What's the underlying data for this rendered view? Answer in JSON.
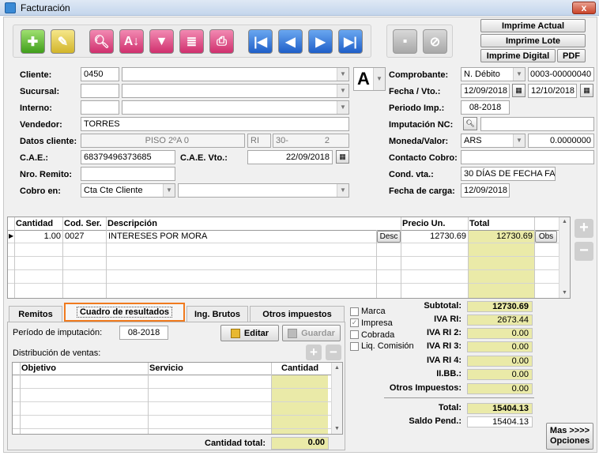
{
  "window": {
    "title": "Facturación",
    "close": "x"
  },
  "toolbar": {
    "right_buttons": {
      "imprime_actual": "Imprime Actual",
      "imprime_lote": "Imprime Lote",
      "imprime_digital": "Imprime Digital",
      "pdf": "PDF"
    }
  },
  "header": {
    "cliente": {
      "label": "Cliente:",
      "code": "0450"
    },
    "sucursal": {
      "label": "Sucursal:"
    },
    "interno": {
      "label": "Interno:"
    },
    "vendedor": {
      "label": "Vendedor:",
      "value": "TORRES"
    },
    "datos_cliente": {
      "label": "Datos cliente:",
      "address": "PISO 2ºA 0",
      "iva": "RI",
      "cuit": "30-",
      "cuit_end": "2"
    },
    "cae": {
      "label": "C.A.E.:",
      "value": "68379496373685",
      "vto_label": "C.A.E. Vto.:",
      "vto": "22/09/2018"
    },
    "nro_remito": {
      "label": "Nro. Remito:"
    },
    "cobro_en": {
      "label": "Cobro en:",
      "value": "Cta Cte Cliente"
    },
    "letter": "A",
    "comprobante": {
      "label": "Comprobante:",
      "type": "N. Débito",
      "number": "0003-00000040"
    },
    "fecha_vto": {
      "label": "Fecha / Vto.:",
      "fecha": "12/09/2018",
      "vto": "12/10/2018"
    },
    "periodo_imp": {
      "label": "Periodo Imp.:",
      "value": "08-2018"
    },
    "imputacion_nc": {
      "label": "Imputación NC:"
    },
    "moneda": {
      "label": "Moneda/Valor:",
      "value": "ARS",
      "rate": "0.0000000"
    },
    "contacto_cobro": {
      "label": "Contacto Cobro:"
    },
    "cond_vta": {
      "label": "Cond. vta.:",
      "value": "30 DÍAS DE FECHA FAC"
    },
    "fecha_carga": {
      "label": "Fecha de carga:",
      "value": "12/09/2018"
    }
  },
  "items": {
    "columns": {
      "cantidad": "Cantidad",
      "cod_ser": "Cod. Ser.",
      "descripcion": "Descripción",
      "precio": "Precio Un.",
      "total": "Total"
    },
    "rows": [
      {
        "cantidad": "1.00",
        "cod": "0027",
        "descripcion": "INTERESES POR MORA",
        "desc_btn": "Desc",
        "precio": "12730.69",
        "total": "12730.69",
        "obs_btn": "Obs"
      }
    ]
  },
  "tabs": {
    "remitos": "Remitos",
    "cuadro": "Cuadro de resultados",
    "ing_brutos": "Ing. Brutos",
    "otros": "Otros impuestos"
  },
  "cuadro": {
    "periodo_label": "Período de imputación:",
    "periodo_value": "08-2018",
    "editar": "Editar",
    "guardar": "Guardar",
    "distribucion_label": "Distribución de ventas:",
    "columns": {
      "objetivo": "Objetivo",
      "servicio": "Servicio",
      "cantidad": "Cantidad"
    },
    "cantidad_total_label": "Cantidad total:",
    "cantidad_total": "0.00"
  },
  "flags": {
    "marca": "Marca",
    "impresa": "Impresa",
    "cobrada": "Cobrada",
    "liq_comision": "Liq. Comisión"
  },
  "totals": {
    "subtotal": {
      "label": "Subtotal:",
      "value": "12730.69"
    },
    "iva_ri": {
      "label": "IVA RI:",
      "value": "2673.44"
    },
    "iva_ri2": {
      "label": "IVA RI 2:",
      "value": "0.00"
    },
    "iva_ri3": {
      "label": "IVA RI 3:",
      "value": "0.00"
    },
    "iva_ri4": {
      "label": "IVA RI 4:",
      "value": "0.00"
    },
    "iibb": {
      "label": "II.BB.:",
      "value": "0.00"
    },
    "otros": {
      "label": "Otros Impuestos:",
      "value": "0.00"
    },
    "total": {
      "label": "Total:",
      "value": "15404.13"
    },
    "saldo": {
      "label": "Saldo Pend.:",
      "value": "15404.13"
    }
  },
  "mas_opciones": {
    "line1": "Mas >>>>",
    "line2": "Opciones"
  }
}
